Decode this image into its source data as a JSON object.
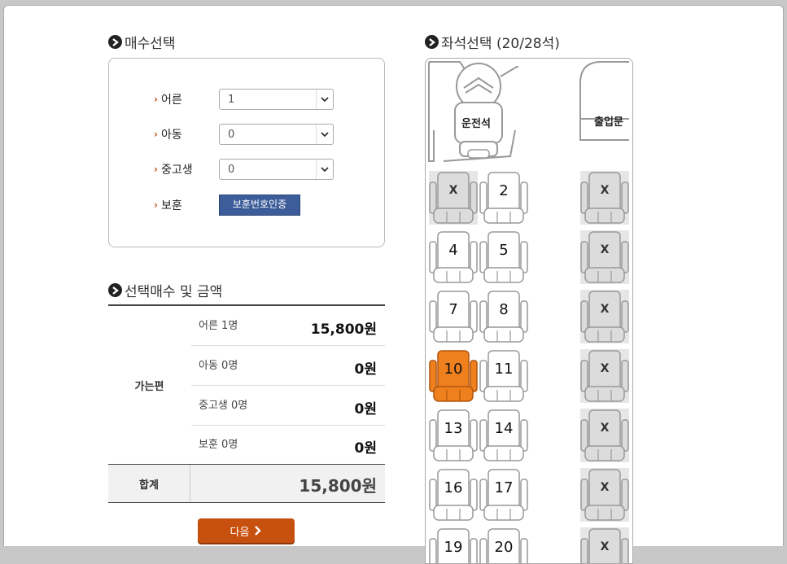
{
  "ticket_section": {
    "title": "매수선택"
  },
  "fields": [
    {
      "label": "어른",
      "value": "1"
    },
    {
      "label": "아동",
      "value": "0"
    },
    {
      "label": "중고생",
      "value": "0"
    }
  ],
  "veteran": {
    "label": "보훈",
    "button": "보훈번호인증"
  },
  "summary": {
    "title": "선택매수 및 금액",
    "group_label": "가는편",
    "rows": [
      {
        "label": "어른 1명",
        "amount": "15,800원"
      },
      {
        "label": "아동 0명",
        "amount": "0원"
      },
      {
        "label": "중고생 0명",
        "amount": "0원"
      },
      {
        "label": "보훈 0명",
        "amount": "0원"
      }
    ],
    "total_label": "합계",
    "total_amount": "15,800원"
  },
  "next_button": "다음",
  "seat_section": {
    "title": "좌석선택 (20/28석)",
    "driver_label": "운전석",
    "door_label": "출입문"
  },
  "seats": [
    {
      "label": "X",
      "status": "sold"
    },
    {
      "label": "2",
      "status": "available"
    },
    {
      "label": "X",
      "status": "sold"
    },
    {
      "label": "4",
      "status": "available"
    },
    {
      "label": "5",
      "status": "available"
    },
    {
      "label": "X",
      "status": "sold"
    },
    {
      "label": "7",
      "status": "available"
    },
    {
      "label": "8",
      "status": "available"
    },
    {
      "label": "X",
      "status": "sold"
    },
    {
      "label": "10",
      "status": "selected"
    },
    {
      "label": "11",
      "status": "available"
    },
    {
      "label": "X",
      "status": "sold"
    },
    {
      "label": "13",
      "status": "available"
    },
    {
      "label": "14",
      "status": "available"
    },
    {
      "label": "X",
      "status": "sold"
    },
    {
      "label": "16",
      "status": "available"
    },
    {
      "label": "17",
      "status": "available"
    },
    {
      "label": "X",
      "status": "sold"
    },
    {
      "label": "19",
      "status": "available"
    },
    {
      "label": "20",
      "status": "available"
    },
    {
      "label": "X",
      "status": "sold"
    }
  ],
  "colors": {
    "selected": "#f07f1e",
    "veteran_button": "#3c5d99",
    "next_button": "#c8500f",
    "sold": "#e6e6e6"
  }
}
